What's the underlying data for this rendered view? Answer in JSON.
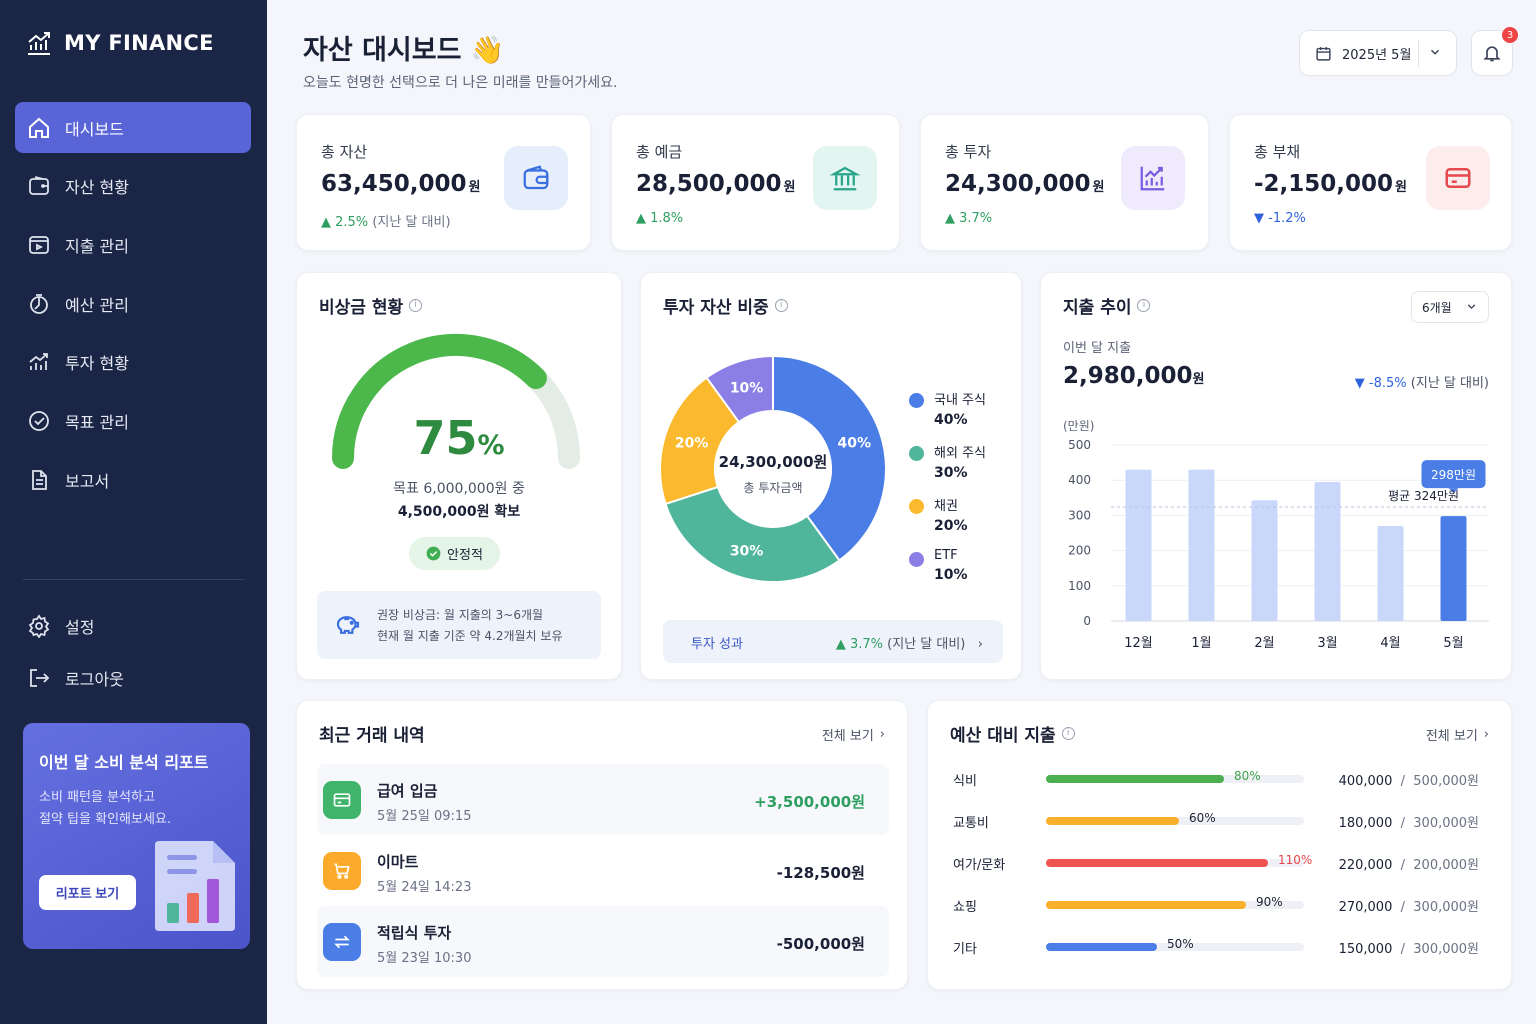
{
  "app": {
    "name": "MY FINANCE"
  },
  "nav": [
    {
      "label": "대시보드",
      "icon": "home-icon",
      "active": true
    },
    {
      "label": "자산 현황",
      "icon": "wallet-icon"
    },
    {
      "label": "지출 관리",
      "icon": "receipt-icon"
    },
    {
      "label": "예산 관리",
      "icon": "pie-clock-icon"
    },
    {
      "label": "투자 현황",
      "icon": "chart-up-icon"
    },
    {
      "label": "목표 관리",
      "icon": "target-icon"
    },
    {
      "label": "보고서",
      "icon": "document-icon"
    }
  ],
  "bottom_nav": [
    {
      "label": "설정",
      "icon": "gear-icon"
    },
    {
      "label": "로그아웃",
      "icon": "logout-icon"
    }
  ],
  "promo": {
    "title": "이번 달 소비 분석 리포트",
    "desc1": "소비 패턴을 분석하고",
    "desc2": "절약 팁을 확인해보세요.",
    "button": "리포트 보기"
  },
  "header": {
    "title": "자산 대시보드 👋",
    "subtitle": "오늘도 현명한 선택으로 더 나은 미래를 만들어가세요.",
    "date": "2025년 5월",
    "notifications": "3"
  },
  "stats": [
    {
      "label": "총 자산",
      "value": "63,450,000",
      "unit": "원",
      "change": "▲ 2.5%",
      "change_sub": "(지난 달 대비)",
      "dir": "up",
      "icon": "wallet-icon",
      "icon_bg": "#e6eefc",
      "icon_color": "#3a6fe0"
    },
    {
      "label": "총 예금",
      "value": "28,500,000",
      "unit": "원",
      "change": "▲ 1.8%",
      "change_sub": "",
      "dir": "up",
      "icon": "bank-icon",
      "icon_bg": "#e2f5f0",
      "icon_color": "#2aa58a"
    },
    {
      "label": "총 투자",
      "value": "24,300,000",
      "unit": "원",
      "change": "▲ 3.7%",
      "change_sub": "",
      "dir": "up",
      "icon": "investment-chart-icon",
      "icon_bg": "#efeafc",
      "icon_color": "#7b5ce0"
    },
    {
      "label": "총 부채",
      "value": "-2,150,000",
      "unit": "원",
      "change": "▼ -1.2%",
      "change_sub": "",
      "dir": "down",
      "icon": "credit-card-icon",
      "icon_bg": "#fdecec",
      "icon_color": "#e5484d"
    }
  ],
  "emergency": {
    "title": "비상금 현황",
    "percent": 75,
    "percent_value": "75",
    "percent_sign": "%",
    "line1": "목표 6,000,000원 중",
    "line2": "4,500,000원 확보",
    "status": "안정적",
    "rec1": "권장 비상금: 월 지출의 3~6개월",
    "rec2": "현재 월 지출 기준 약 4.2개월치 보유"
  },
  "allocation": {
    "title": "투자 자산 비중",
    "center_value": "24,300,000원",
    "center_label": "총 투자금액",
    "slices": [
      {
        "name": "국내 주식",
        "value": 40,
        "label": "40%",
        "color": "#4a7de6"
      },
      {
        "name": "해외 주식",
        "value": 30,
        "label": "30%",
        "color": "#4fb59b"
      },
      {
        "name": "채권",
        "value": 20,
        "label": "20%",
        "color": "#fbb92d"
      },
      {
        "name": "ETF",
        "value": 10,
        "label": "10%",
        "color": "#8b7fe6"
      }
    ],
    "perf_label": "투자 성과",
    "perf_change": "▲ 3.7%",
    "perf_sub": "(지난 달 대비)"
  },
  "spending": {
    "title": "지출 추이",
    "period": "6개월",
    "month_label": "이번 달 지출",
    "month_value": "2,980,000",
    "month_unit": "원",
    "change": "▼ -8.5%",
    "change_sub": "(지난 달 대비)",
    "unit_label": "(만원)",
    "avg_label": "평균 324만원",
    "highlight_label": "298만원"
  },
  "chart_data": {
    "type": "bar",
    "categories": [
      "12월",
      "1월",
      "2월",
      "3월",
      "4월",
      "5월"
    ],
    "values": [
      430,
      430,
      343,
      395,
      270,
      298
    ],
    "ylabel": "(만원)",
    "ylim": [
      0,
      500
    ],
    "yticks": [
      0,
      100,
      200,
      300,
      400,
      500
    ],
    "average": 324,
    "highlight_index": 5,
    "colors": {
      "bar": "#c9d7fb",
      "highlight": "#4a7de6"
    }
  },
  "transactions": {
    "title": "최근 거래 내역",
    "view_all": "전체 보기",
    "items": [
      {
        "name": "급여 입금",
        "date": "5월 25일 09:15",
        "amount": "+3,500,000원",
        "positive": true,
        "icon": "card-icon",
        "color": "#3fb46a"
      },
      {
        "name": "이마트",
        "date": "5월 24일 14:23",
        "amount": "-128,500원",
        "positive": false,
        "icon": "cart-icon",
        "color": "#fbaa2b"
      },
      {
        "name": "적립식 투자",
        "date": "5월 23일 10:30",
        "amount": "-500,000원",
        "positive": false,
        "icon": "exchange-icon",
        "color": "#4a7de6"
      }
    ]
  },
  "budget": {
    "title": "예산 대비 지출",
    "view_all": "전체 보기",
    "items": [
      {
        "name": "식비",
        "percent": 80,
        "label": "80%",
        "spent": "400,000",
        "total": "500,000원",
        "color": "#4caf50",
        "label_color": "#3fa34d"
      },
      {
        "name": "교통비",
        "percent": 60,
        "label": "60%",
        "spent": "180,000",
        "total": "300,000원",
        "color": "#fbb02c",
        "label_color": "#1a2035"
      },
      {
        "name": "여가/문화",
        "percent": 110,
        "label": "110%",
        "spent": "220,000",
        "total": "200,000원",
        "color": "#ef5350",
        "label_color": "#e5484d"
      },
      {
        "name": "쇼핑",
        "percent": 90,
        "label": "90%",
        "spent": "270,000",
        "total": "300,000원",
        "color": "#fbb02c",
        "label_color": "#1a2035"
      },
      {
        "name": "기타",
        "percent": 50,
        "label": "50%",
        "spent": "150,000",
        "total": "300,000원",
        "color": "#4a7de6",
        "label_color": "#1a2035"
      }
    ]
  }
}
